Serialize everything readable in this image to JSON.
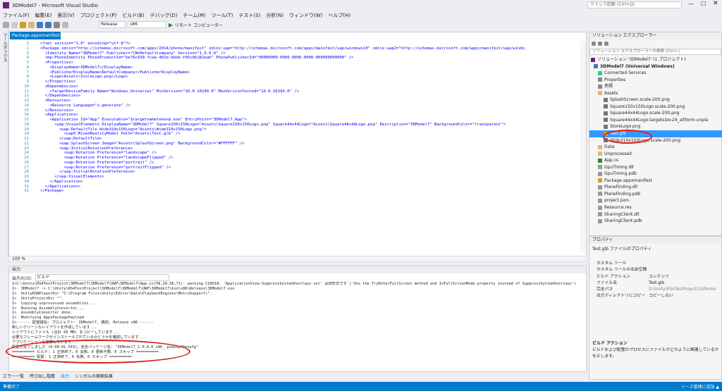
{
  "window": {
    "title": "3DModel7 - Microsoft Visual Studio",
    "quick_launch": "クイック起動 (Ctrl+Q)"
  },
  "menu": [
    "ファイル(F)",
    "編集(E)",
    "表示(V)",
    "プロジェクト(P)",
    "ビルド(B)",
    "デバッグ(D)",
    "チーム(M)",
    "ツール(T)",
    "テスト(S)",
    "分析(N)",
    "ウィンドウ(W)",
    "ヘルプ(H)"
  ],
  "toolbar": {
    "config": "Release",
    "platform": "x86",
    "run_label": "リモート コンピューター"
  },
  "left_tool": "ツールボックス",
  "editor": {
    "tab": "Package.appxmanifest",
    "zoom": "100 %",
    "lines": [
      "<?xml version=\"1.0\" encoding=\"utf-8\"?>",
      "<Package xmlns=\"http://schemas.microsoft.com/appx/2014/phone/manifest\" xmlns:uap=\"http://schemas.microsoft.com/appx/manifest/uap/windows10\" xmlns:uap2=\"http://schemas.microsoft.com/appx/manifest/uap/windo",
      "  <Identity Name=\"3DModel7\" Publisher=\"CN=DefaultCompany\" Version=\"1.0.0.0\" />",
      "  <mp:PhoneIdentity PhoneProductId=\"be76c939-fcaa-481d-bbeb-fd5c96182eab\" PhonePublisherId=\"00000000-0000-0000-0000-000000000000\" />",
      "  <Properties>",
      "    <DisplayName>3DModel7</DisplayName>",
      "    <PublisherDisplayName>DefaultCompany</PublisherDisplayName>",
      "    <Logo>Assets\\StoreLogo.png</Logo>",
      "  </Properties>",
      "  <Dependencies>",
      "    <TargetDeviceFamily Name=\"Windows.Universal\" MinVersion=\"10.0.10240.0\" MaxVersionTested=\"10.0.16299.0\" />",
      "  </Dependencies>",
      "  <Resources>",
      "    <Resource Language=\"x-generate\" />",
      "  </Resources>",
      "  <Applications>",
      "    <Application Id=\"App\" Executable=\"$targetnametoken$.exe\" EntryPoint=\"3DModel7.App\">",
      "      <uap:VisualElements DisplayName=\"3DModel7\" Square150x150Logo=\"Assets\\Square150x150Logo.png\" Square44x44Logo=\"Assets\\Square44x44Logo.png\" Description=\"3DModel7\" BackgroundColor=\"transparent\">",
      "        <uap:DefaultTile Wide310x150Logo=\"Assets\\Wide310x150Logo.png\">",
      "          <uap5:MixedRealityModel Path=\"Assets\\Test.glb\" />",
      "        </uap:DefaultTile>",
      "        <uap:SplashScreen Image=\"Assets\\SplashScreen.png\" BackgroundColor=\"#FFFFFF\" />",
      "        <uap:InitialRotationPreference>",
      "          <uap:Rotation Preference=\"landscape\" />",
      "          <uap:Rotation Preference=\"landscapeFlipped\" />",
      "          <uap:Rotation Preference=\"portrait\" />",
      "          <uap:Rotation Preference=\"portraitFlipped\" />",
      "        </uap:InitialRotationPreference>",
      "      </uap:VisualElements>",
      "    </Application>",
      "  </Applications>",
      "</Package>"
    ]
  },
  "output": {
    "title": "出力",
    "source_label": "出力元(S):",
    "source_value": "ビルド",
    "lines": [
      "1>C:\\Unity\\RS4TestProject\\3DModel7\\3DModel7\\UWP\\3DModel7\\App.cs(58,10,58,71): warning CS0618: 'ApplicationView.SuppressSystemOverlays.set' は旧形式です ('Use the TryEnterFullScreen method and IsFullScreenMode property instead of SuppressSystemOverlays')",
      "1>  3DModel7 -> C:\\Unity\\RS4TestProject\\3DModel7\\3DModel7\\UWP\\3DModel7\\bin\\x86\\Release\\3DModel7.exe",
      "1>  UnityRSWPlayerDir \"C:\\Program Files\\Unity\\Editor\\Data\\PlaybackEngines\\MetroSupport\\\".",
      "1>  UnityProjectDir \"\".",
      "1>  Copying unprocessed assemblies...",
      "1>  Running AssemblyConverter...",
      "1>  AssemblyConverter done.",
      "1>  Modifying AppxPackagePayload",
      "2>------ 配置開始: プロジェクト: 3DModel7, 構成: Release x86 ------",
      "新しいクリーンなレイアウトを作成しています...",
      "レイアウトにファイル (合計 66 MB) をコピーしています...",
      "必要なフレームワークがインストールされているかどうかを確認しています...",
      "アプリケーションを登録しています...",
      "配置が完了しました (0:00:41.543)。完全パッケージ名: \"3DModel7_1.0.0.0_x86__pzq3xp76mxafg\"",
      "========== ビルド: 1 正常終了、0 失敗、0 更新不要、0 スキップ ==========",
      "========== 配置: 1 正常終了、0 失敗、0 スキップ =========="
    ]
  },
  "bottom_tabs": [
    "エラー一覧",
    "呼び出し階層",
    "出力",
    "シンボルの検索結果"
  ],
  "status": {
    "left": "準備完了",
    "right": "ソース管理に追加 ▲"
  },
  "solution": {
    "title": "ソリューション エクスプローラー",
    "search": "ソリューション エクスプローラーの検索 (Ctrl+;)",
    "items": [
      "ソリューション '3DModel7' (1 プロジェクト)",
      "3DModel7 (Universal Windows)",
      "Connected Services",
      "Properties",
      "参照",
      "Assets",
      "SplashScreen.scale-200.png",
      "Square150x150Logo.scale-200.png",
      "Square44x44Logo.scale-200.png",
      "Square44x44Logo.targetsize-24_altform-unpla",
      "StoreLogo.png",
      "Test.glb",
      "Wide310x150Logo.scale-200.png",
      "Data",
      "Unprocessed",
      "App.cs",
      "GpuTiming.dll",
      "GpuTiming.pdb",
      "Package.appxmanifest",
      "PlaneFinding.dll",
      "PlaneFinding.pdb",
      "project.json",
      "Resource.res",
      "SharingClient.dll",
      "SharingClient.pdb"
    ]
  },
  "properties": {
    "title": "プロパティ",
    "header": "Test.glb ファイルのプロパティ",
    "rows": [
      [
        "カスタム ツール",
        ""
      ],
      [
        "カスタム ツールの名前空間",
        ""
      ],
      [
        "ビルド アクション",
        "コンテンツ"
      ],
      [
        "ファイル名",
        "Test.glb"
      ],
      [
        "完全パス",
        "D:\\Unity\\RS4TestProject\\3DModel"
      ],
      [
        "出力ディレクトリにコピー",
        "コピーしない"
      ]
    ],
    "desc_title": "ビルド アクション",
    "desc": "ビルドおよび配置のプロセスにファイルがどのように関連しているかを示します。"
  }
}
